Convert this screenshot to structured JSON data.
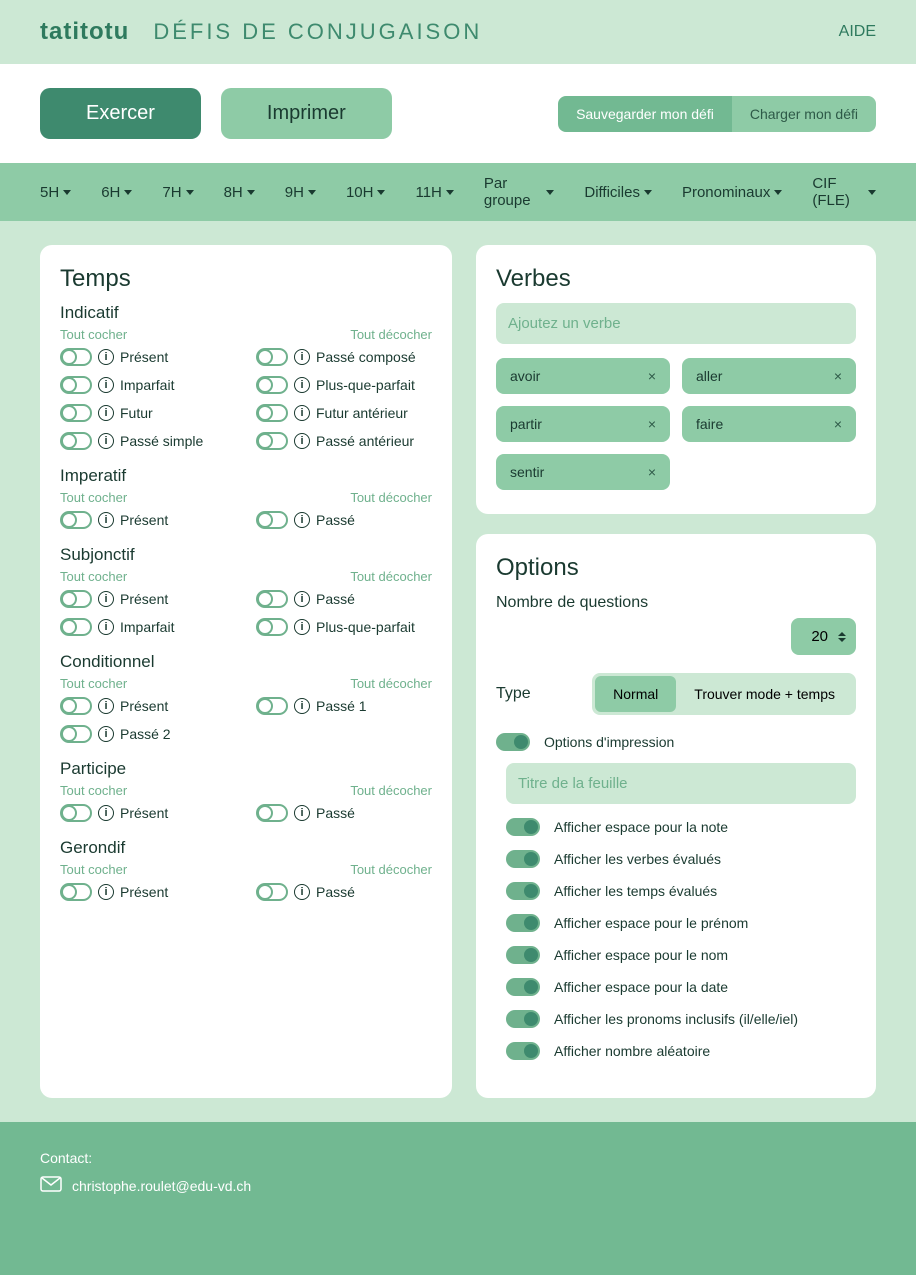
{
  "header": {
    "logo": "tatitotu",
    "subtitle": "DÉFIS DE CONJUGAISON",
    "help": "AIDE"
  },
  "topbar": {
    "tab_exercer": "Exercer",
    "tab_imprimer": "Imprimer",
    "save": "Sauvegarder mon défi",
    "load": "Charger mon défi"
  },
  "nav": [
    "5H",
    "6H",
    "7H",
    "8H",
    "9H",
    "10H",
    "11H",
    "Par groupe",
    "Difficiles",
    "Pronominaux",
    "CIF (FLE)"
  ],
  "temps": {
    "title": "Temps",
    "tout_cocher": "Tout cocher",
    "tout_decocher": "Tout décocher",
    "moods": [
      {
        "name": "Indicatif",
        "tenses": [
          "Présent",
          "Passé composé",
          "Imparfait",
          "Plus-que-parfait",
          "Futur",
          "Futur antérieur",
          "Passé simple",
          "Passé antérieur"
        ]
      },
      {
        "name": "Imperatif",
        "tenses": [
          "Présent",
          "Passé"
        ]
      },
      {
        "name": "Subjonctif",
        "tenses": [
          "Présent",
          "Passé",
          "Imparfait",
          "Plus-que-parfait"
        ]
      },
      {
        "name": "Conditionnel",
        "tenses": [
          "Présent",
          "Passé 1",
          "Passé 2"
        ]
      },
      {
        "name": "Participe",
        "tenses": [
          "Présent",
          "Passé"
        ]
      },
      {
        "name": "Gerondif",
        "tenses": [
          "Présent",
          "Passé"
        ]
      }
    ]
  },
  "verbes": {
    "title": "Verbes",
    "placeholder": "Ajoutez un verbe",
    "chips": [
      "avoir",
      "aller",
      "partir",
      "faire",
      "sentir"
    ]
  },
  "options": {
    "title": "Options",
    "nb_label": "Nombre de questions",
    "nb_value": "20",
    "type_label": "Type",
    "type_normal": "Normal",
    "type_mode": "Trouver mode + temps",
    "print_options": "Options d'impression",
    "sheet_placeholder": "Titre de la feuille",
    "opts": [
      "Afficher espace pour la note",
      "Afficher les verbes évalués",
      "Afficher les temps évalués",
      "Afficher espace pour le prénom",
      "Afficher espace pour le nom",
      "Afficher espace pour la date",
      "Afficher les pronoms inclusifs (il/elle/iel)",
      "Afficher nombre aléatoire"
    ]
  },
  "footer": {
    "contact": "Contact:",
    "email": "christophe.roulet@edu-vd.ch"
  }
}
